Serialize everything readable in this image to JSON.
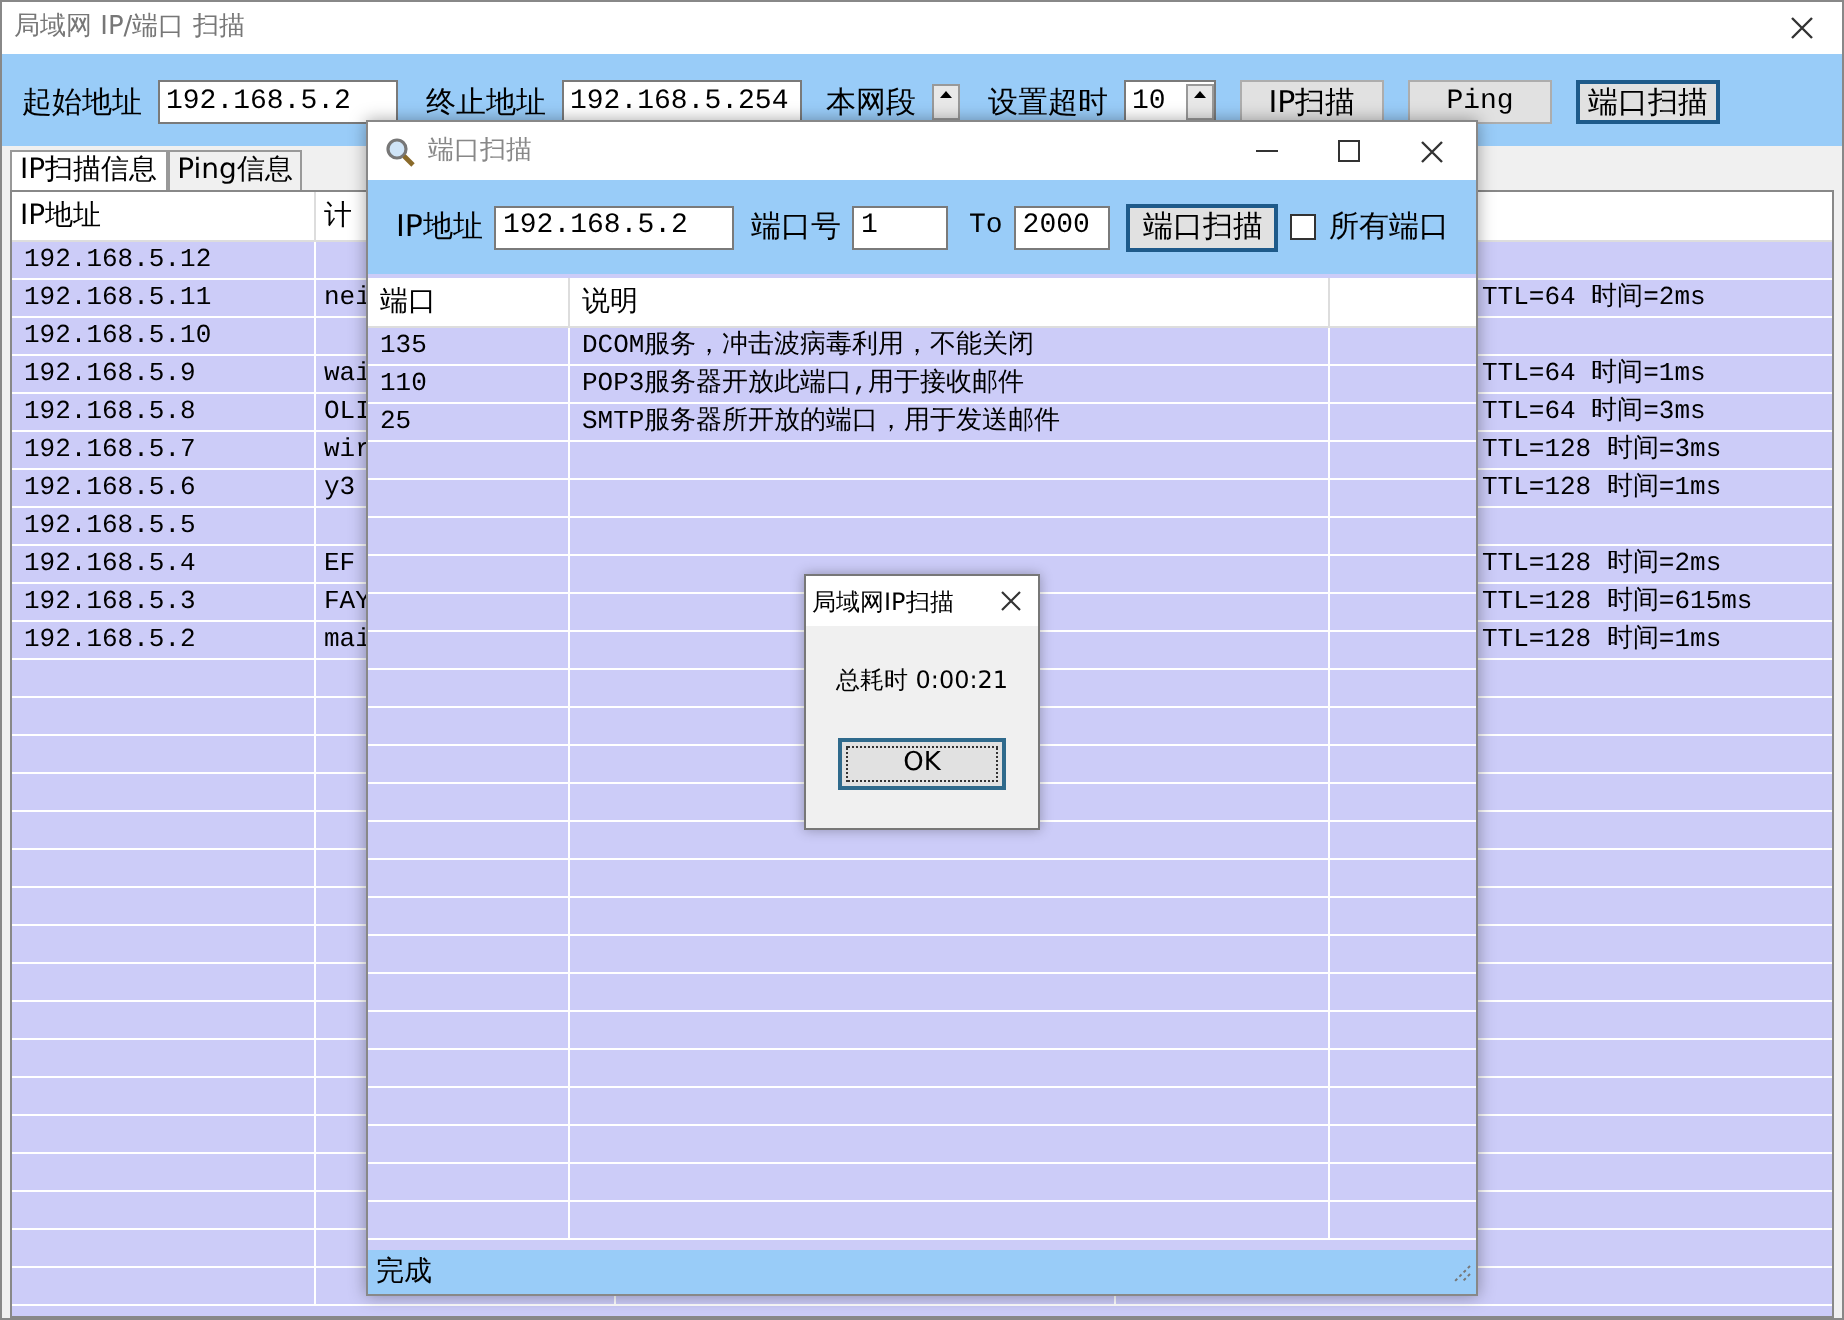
{
  "main_window": {
    "title": "局域网 IP/端口 扫描",
    "toolbar": {
      "start_label": "起始地址",
      "start_value": "192.168.5.2",
      "end_label": "终止地址",
      "end_value": "192.168.5.254",
      "segment_label": "本网段",
      "timeout_label": "设置超时",
      "timeout_value": "10",
      "buttons": [
        {
          "label": "IP扫描",
          "focused": false
        },
        {
          "label": "Ping",
          "focused": false
        },
        {
          "label": "端口扫描",
          "focused": true
        }
      ]
    },
    "tabs": [
      {
        "label": "IP扫描信息",
        "selected": true
      },
      {
        "label": "Ping信息",
        "selected": false
      }
    ],
    "table": {
      "columns": [
        "IP地址",
        "计"
      ],
      "rows": [
        {
          "ip": "192.168.5.12",
          "column_2": "",
          "reply": ""
        },
        {
          "ip": "192.168.5.11",
          "column_2": "nei",
          "reply": "TTL=64 时间=2ms"
        },
        {
          "ip": "192.168.5.10",
          "column_2": "",
          "reply": ""
        },
        {
          "ip": "192.168.5.9",
          "column_2": "wai",
          "reply": "TTL=64 时间=1ms"
        },
        {
          "ip": "192.168.5.8",
          "column_2": "OLI",
          "reply": "TTL=64 时间=3ms"
        },
        {
          "ip": "192.168.5.7",
          "column_2": "wir",
          "reply": "TTL=128 时间=3ms"
        },
        {
          "ip": "192.168.5.6",
          "column_2": "y3",
          "reply": "TTL=128 时间=1ms"
        },
        {
          "ip": "192.168.5.5",
          "column_2": "",
          "reply": ""
        },
        {
          "ip": "192.168.5.4",
          "column_2": "EF",
          "reply": "TTL=128 时间=2ms"
        },
        {
          "ip": "192.168.5.3",
          "column_2": "FAY",
          "reply": "TTL=128 时间=615ms"
        },
        {
          "ip": "192.168.5.2",
          "column_2": "mai",
          "reply": "TTL=128 时间=1ms"
        }
      ]
    }
  },
  "port_window": {
    "title": "端口扫描",
    "ip_label": "IP地址",
    "ip_value": "192.168.5.2",
    "port_label": "端口号",
    "port_from": "1",
    "to_label": "To",
    "port_to": "2000",
    "scan_button": "端口扫描",
    "all_ports": {
      "label": "所有端口",
      "checked": false
    },
    "table": {
      "columns": [
        "端口",
        "说明"
      ],
      "rows": [
        {
          "port": "135",
          "description": "DCOM服务，冲击波病毒利用，不能关闭"
        },
        {
          "port": "110",
          "description": "POP3服务器开放此端口,用于接收邮件"
        },
        {
          "port": "25",
          "description": "SMTP服务器所开放的端口，用于发送邮件"
        }
      ]
    },
    "status": "完成"
  },
  "dialog": {
    "title": "局域网IP扫描",
    "message": "总耗时 0:00:21",
    "ok_button": "OK"
  }
}
